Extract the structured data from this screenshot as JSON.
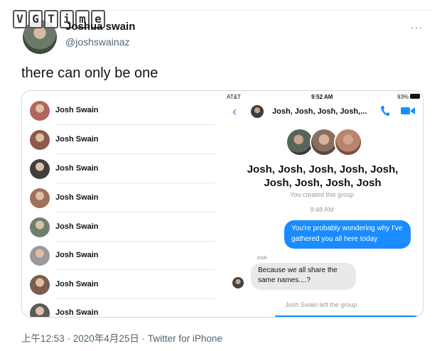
{
  "header": {
    "watermark_letters": [
      "V",
      "G",
      "T",
      "i",
      "m",
      "e"
    ],
    "author_name": "Joshua swain",
    "author_handle": "@joshswainaz",
    "more_label": "···"
  },
  "tweet": {
    "text": "there can only be one",
    "footer": "上午12:53 · 2020年4月25日 · Twitter for iPhone"
  },
  "screenshot": {
    "contacts": [
      {
        "name": "Josh Swain",
        "color": "#b0675a"
      },
      {
        "name": "Josh Swain",
        "color": "#8c5a4a"
      },
      {
        "name": "Josh Swain",
        "color": "#3f3f3f"
      },
      {
        "name": "Josh Swain",
        "color": "#a07058"
      },
      {
        "name": "Josh Swain",
        "color": "#6f7f6e"
      },
      {
        "name": "Josh Swain",
        "color": "#9a9a9a"
      },
      {
        "name": "Josh Swain",
        "color": "#7a5d4a"
      },
      {
        "name": "Josh Swain",
        "color": "#5a5a5a"
      }
    ],
    "status_bar": {
      "carrier": "AT&T",
      "time": "9:52 AM",
      "battery": "93%"
    },
    "nav": {
      "back_icon": "chevron-left-icon",
      "title": "Josh, Josh, Josh, Josh,...",
      "accent_color": "#1a8cff"
    },
    "group_title_line1": "Josh, Josh, Josh, Josh, Josh,",
    "group_title_line2": "Josh, Josh, Josh, Josh",
    "created_note": "You created this group",
    "timestamp": "9:48 AM",
    "outgoing_message": "You're probably wondering why I've gathered you all here today",
    "sender_label": "Josh",
    "incoming_message": "Because we all share the same names....?",
    "left_note": "Josh Swain left the group."
  }
}
